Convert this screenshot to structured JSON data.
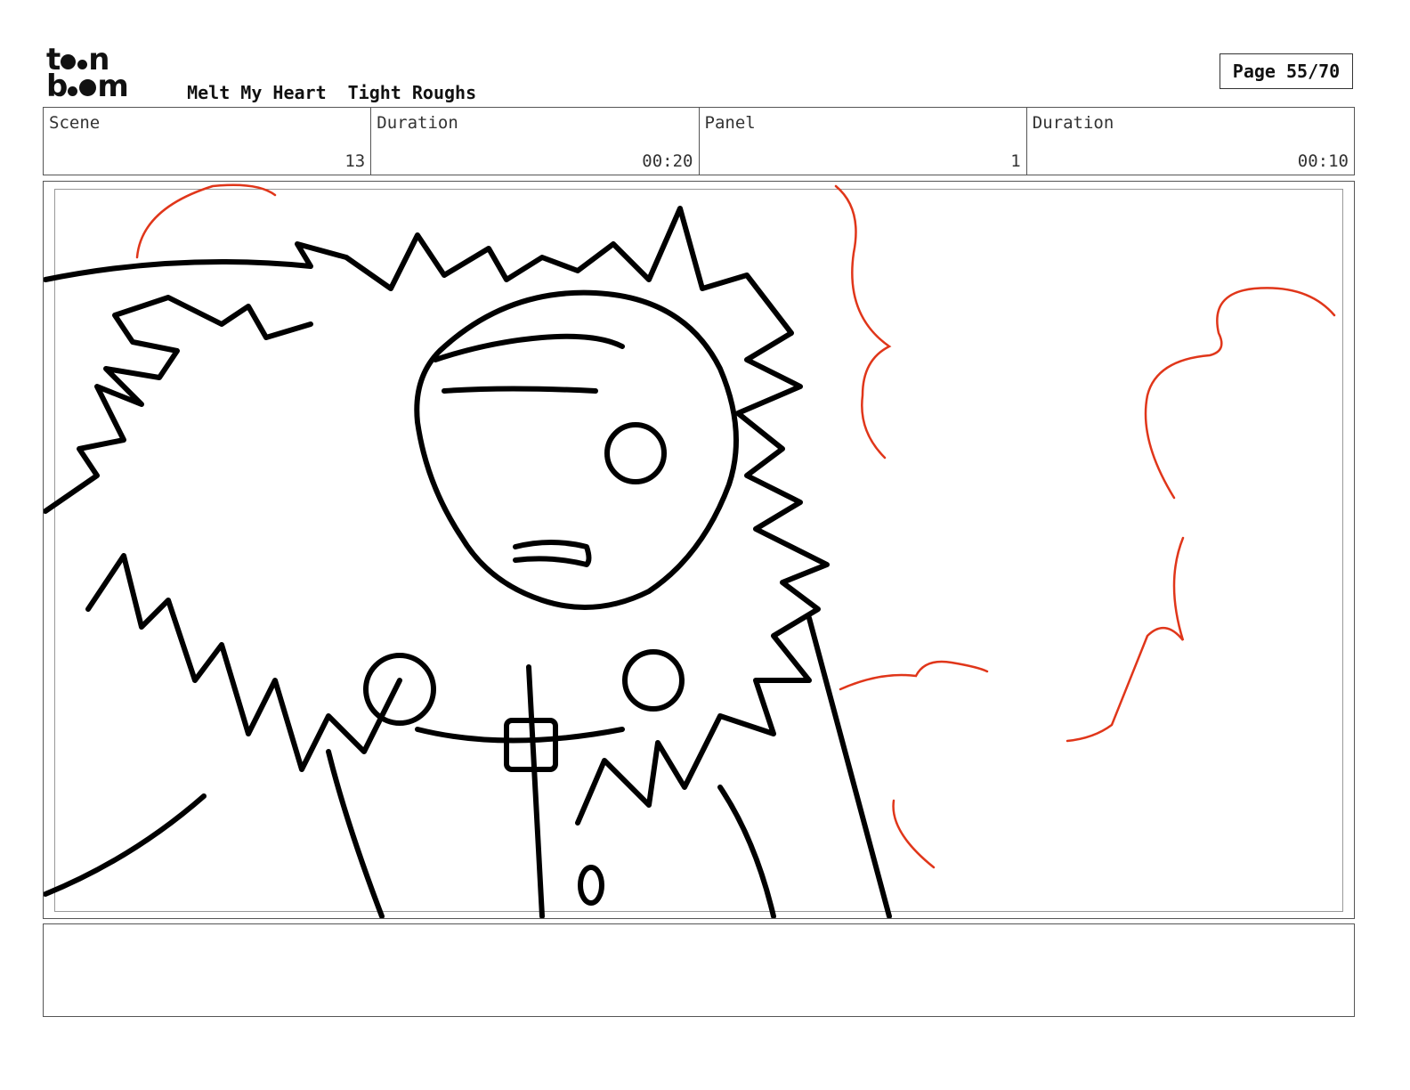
{
  "header": {
    "logo": {
      "line1": "toon",
      "line2": "boom",
      "icon": "toon-boom-logo"
    },
    "project_title": "Melt My Heart",
    "stage_title": "Tight Roughs",
    "page_label": "Page 55/70"
  },
  "info_bar": {
    "scene_label": "Scene",
    "scene_value": "13",
    "scene_duration_label": "Duration",
    "scene_duration_value": "00:20",
    "panel_label": "Panel",
    "panel_value": "1",
    "panel_duration_label": "Duration",
    "panel_duration_value": "00:10"
  },
  "panel_drawing": {
    "description_icon": "storyboard-sketch",
    "line_color": "#000000",
    "accent_color": "#e0361a"
  },
  "notes": {
    "text": ""
  }
}
